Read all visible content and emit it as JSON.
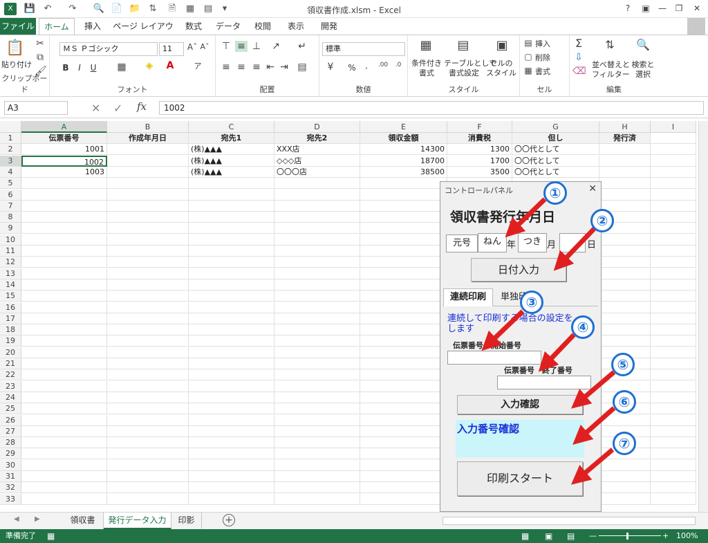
{
  "title_bar": {
    "title": "領収書作成.xlsm - Excel",
    "help": "?"
  },
  "ribbon_tabs": [
    "ファイル",
    "ホーム",
    "挿入",
    "ページ レイアウト",
    "数式",
    "データ",
    "校閲",
    "表示",
    "開発"
  ],
  "ribbon": {
    "clipboard": {
      "paste": "貼り付け",
      "label": "クリップボード"
    },
    "font": {
      "name": "ＭＳ Ｐゴシック",
      "size": "11",
      "label": "フォント",
      "bold": "B",
      "italic": "I",
      "underline": "U"
    },
    "alignment": {
      "label": "配置"
    },
    "number": {
      "format": "標準",
      "label": "数値",
      "percent": "%"
    },
    "styles": {
      "conditional": "条件付き\n書式",
      "table": "テーブルとして\n書式設定",
      "cell": "セルの\nスタイル",
      "label": "スタイル"
    },
    "cells": {
      "insert": "挿入",
      "delete": "削除",
      "format": "書式",
      "label": "セル"
    },
    "editing": {
      "sort": "並べ替えと\nフィルター",
      "find": "検索と\n選択",
      "label": "編集"
    }
  },
  "formula_bar": {
    "name_box": "A3",
    "fx": "fx",
    "value": "1002"
  },
  "columns": [
    "A",
    "B",
    "C",
    "D",
    "E",
    "F",
    "G",
    "H",
    "I"
  ],
  "rows": [
    "1",
    "2",
    "3",
    "4",
    "5",
    "6",
    "7",
    "8",
    "9",
    "10",
    "11",
    "12",
    "13",
    "14",
    "15",
    "16",
    "17",
    "18",
    "19",
    "20",
    "21",
    "22",
    "23",
    "24",
    "25",
    "26",
    "27",
    "28",
    "29",
    "30",
    "31",
    "32",
    "33"
  ],
  "table": {
    "headers": [
      "伝票番号",
      "作成年月日",
      "宛先1",
      "宛先2",
      "領収金額",
      "消費税",
      "但し",
      "発行済"
    ],
    "data": [
      [
        "1001",
        "",
        "(株)▲▲▲",
        "XXX店",
        "14300",
        "1300",
        "〇〇代として",
        ""
      ],
      [
        "1002",
        "",
        "(株)▲▲▲",
        "◇◇◇店",
        "18700",
        "1700",
        "〇〇代として",
        ""
      ],
      [
        "1003",
        "",
        "(株)▲▲▲",
        "〇〇〇店",
        "38500",
        "3500",
        "〇〇代として",
        ""
      ]
    ]
  },
  "sheet_tabs": [
    "領収書",
    "発行データ入力",
    "印影"
  ],
  "status": {
    "ready": "準備完了",
    "zoom": "100%"
  },
  "control_panel": {
    "title": "コントロールパネル",
    "heading": "領収書発行年月日",
    "era": "元号",
    "year_input": "ねん",
    "year_label": "年",
    "month_input": "つき",
    "month_label": "月",
    "day_label": "日",
    "date_button": "日付入力",
    "tab_continuous": "連続印刷",
    "tab_single": "単独印刷",
    "description": "連続して印刷する場合の設定をします",
    "start_label": "伝票番号　開始番号",
    "end_label": "伝票番号　終了番号",
    "confirm_button": "入力確認",
    "confirm_display": "入力番号確認",
    "print_button": "印刷スタート"
  },
  "annotations": [
    "①",
    "②",
    "③",
    "④",
    "⑤",
    "⑥",
    "⑦"
  ],
  "colors": {
    "excel_green": "#217346",
    "annotation_blue": "#1e6fd1",
    "arrow_red": "#e02020",
    "confirm_bg": "#c9f5fb"
  }
}
